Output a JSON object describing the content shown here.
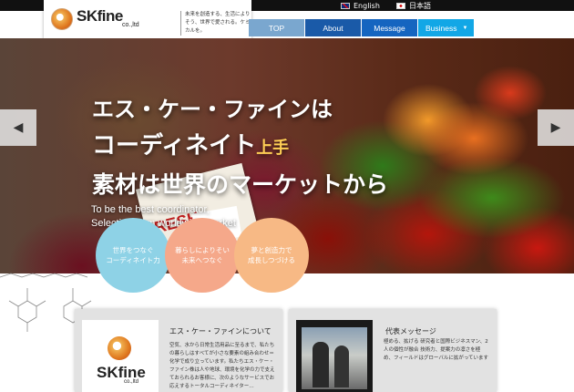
{
  "topbar": {
    "lang_en": "English",
    "lang_ja": "日本語",
    "flag_en_icon": "uk-flag-icon",
    "flag_ja_icon": "japan-flag-icon"
  },
  "logo": {
    "name": "SKfine",
    "suffix": "co.,ltd",
    "tagline": "未来を創造する、生活によりそう、世界で愛される。ケミカルを。"
  },
  "nav": {
    "items": [
      {
        "label": "TOP",
        "color": "#7aa7cf"
      },
      {
        "label": "About",
        "color": "#1a5aa8"
      },
      {
        "label": "Message",
        "color": "#1565c0"
      },
      {
        "label": "Business",
        "color": "#12a7e6"
      }
    ]
  },
  "hero": {
    "title_line1": "エス・ケー・ファインは",
    "title_line2_main": "コーディネイト",
    "title_line2_small": "上手",
    "title_line3": "素材は世界のマーケットから",
    "subtitle_line1": "To be the best coordinator,",
    "subtitle_line2": "Selecting from worldwide market",
    "sign_text": "RESH",
    "prev_icon": "chevron-left-icon",
    "next_icon": "chevron-right-icon"
  },
  "circles": [
    {
      "line1": "世界をつなぐ",
      "line2": "コーディネイト力",
      "color": "#8ed2e6"
    },
    {
      "line1": "暮らしによりそい",
      "line2": "未来へつなぐ",
      "color": "#f5a88a"
    },
    {
      "line1": "夢と創造力で",
      "line2": "成長しつづける",
      "color": "#f7b985"
    }
  ],
  "about": {
    "title": "エス・ケー・ファインについて",
    "body": "空気、水から日常生活用品に至るまで、私たちの暮らしはすべてが小さな要素の組み合わせ＝化学で成り立っています。私たちエス・ケー・ファイン株は人や地球、環境を化学の力で支えておられるお客様に、次のようなサービスでお応えするトータルコーディネイター…",
    "logo_name": "SKfine",
    "logo_suffix": "co.,ltd"
  },
  "message": {
    "title": "代表メッセージ",
    "body": "極める、拡げる 研究者と国際ビジネスマン、2人の個性が融合 技術力、提案力の凛さを極め、フィールドはグローバルに拡がっています"
  }
}
